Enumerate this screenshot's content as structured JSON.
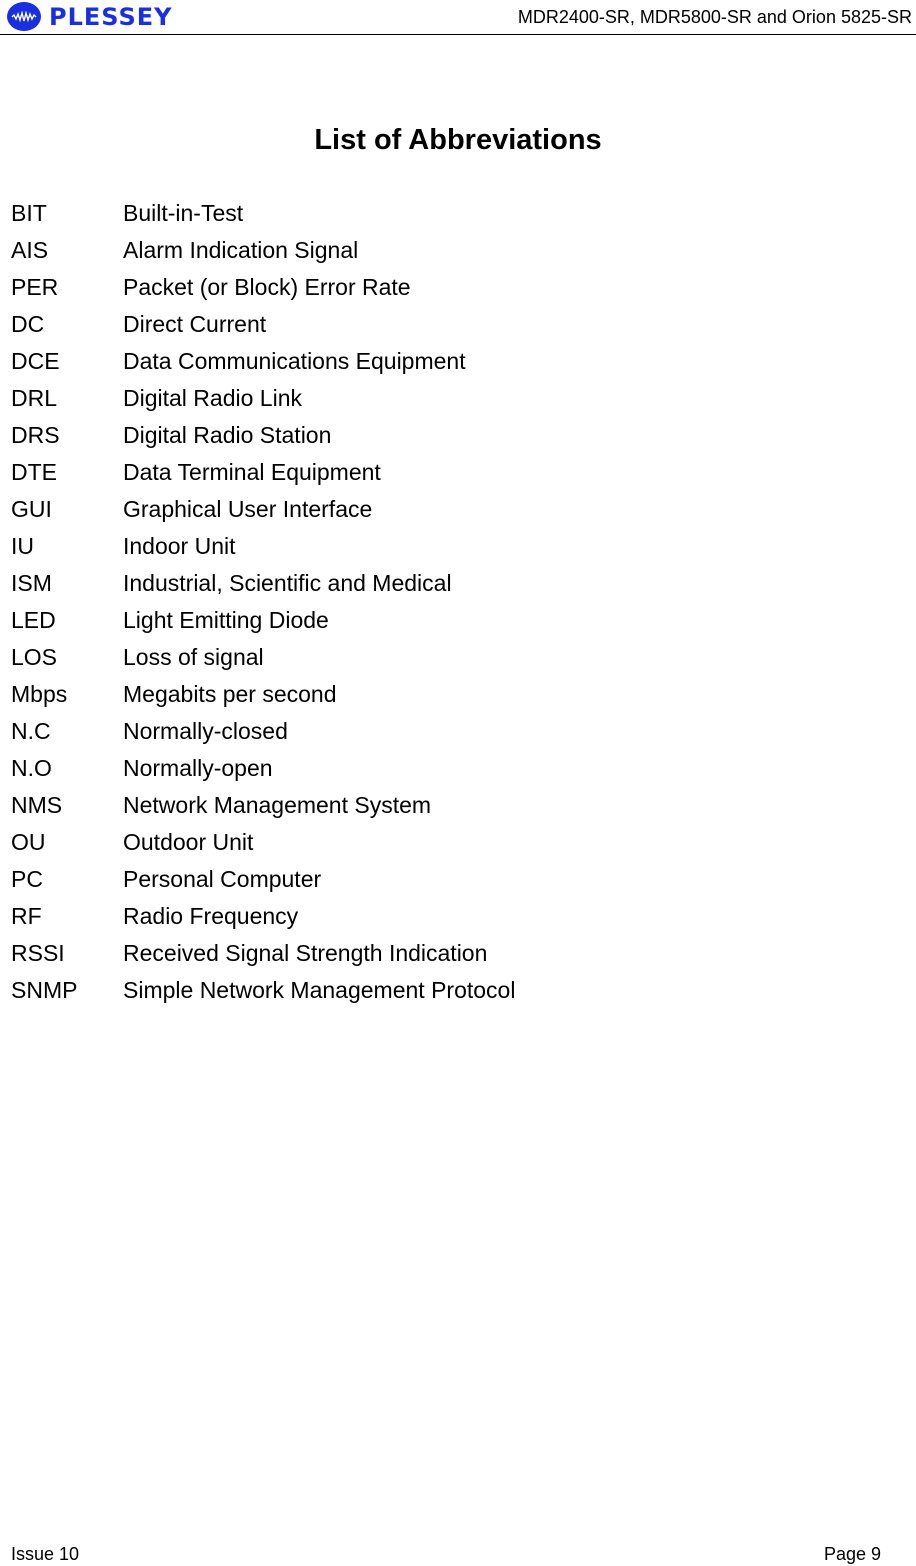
{
  "header": {
    "logo_text": "PLESSEY",
    "logo_icon": "waveform-badge-icon",
    "brand_color": "#1a2fe0",
    "document_title": "MDR2400-SR, MDR5800-SR and Orion 5825-SR"
  },
  "page_title": "List of Abbreviations",
  "abbreviations": [
    {
      "abbr": "BIT",
      "meaning": "Built-in-Test"
    },
    {
      "abbr": "AIS",
      "meaning": "Alarm Indication Signal"
    },
    {
      "abbr": "PER",
      "meaning": "Packet (or Block) Error Rate"
    },
    {
      "abbr": "DC",
      "meaning": "Direct Current"
    },
    {
      "abbr": "DCE",
      "meaning": "Data Communications Equipment"
    },
    {
      "abbr": "DRL",
      "meaning": "Digital Radio Link"
    },
    {
      "abbr": "DRS",
      "meaning": "Digital Radio Station"
    },
    {
      "abbr": "DTE",
      "meaning": "Data Terminal Equipment"
    },
    {
      "abbr": "GUI",
      "meaning": "Graphical User Interface"
    },
    {
      "abbr": "IU",
      "meaning": "Indoor Unit"
    },
    {
      "abbr": "ISM",
      "meaning": "Industrial, Scientific and Medical"
    },
    {
      "abbr": "LED",
      "meaning": "Light Emitting Diode"
    },
    {
      "abbr": "LOS",
      "meaning": "Loss of signal"
    },
    {
      "abbr": "Mbps",
      "meaning": "Megabits per second"
    },
    {
      "abbr": "N.C",
      "meaning": "Normally-closed"
    },
    {
      "abbr": "N.O",
      "meaning": "Normally-open"
    },
    {
      "abbr": "NMS",
      "meaning": "Network Management System"
    },
    {
      "abbr": "OU",
      "meaning": "Outdoor Unit"
    },
    {
      "abbr": "PC",
      "meaning": "Personal Computer"
    },
    {
      "abbr": "RF",
      "meaning": "Radio Frequency"
    },
    {
      "abbr": "RSSI",
      "meaning": "Received Signal Strength Indication"
    },
    {
      "abbr": "SNMP",
      "meaning": "Simple Network Management Protocol"
    }
  ],
  "footer": {
    "issue": "Issue 10",
    "page": "Page 9"
  }
}
